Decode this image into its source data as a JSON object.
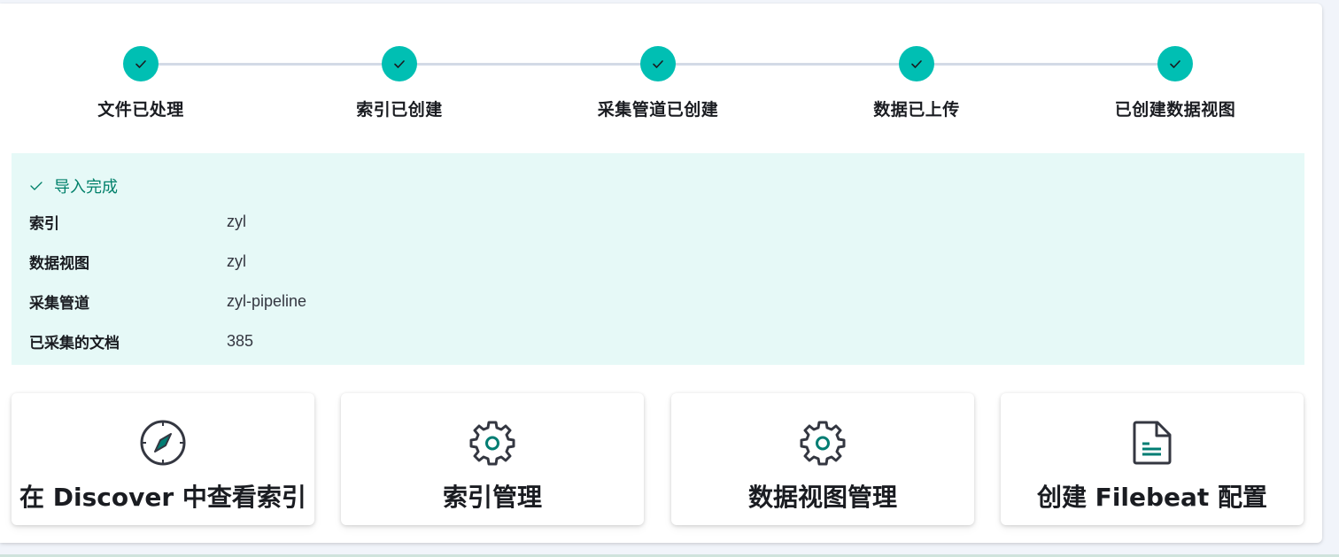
{
  "steps": [
    {
      "title": "文件已处理"
    },
    {
      "title": "索引已创建"
    },
    {
      "title": "采集管道已创建"
    },
    {
      "title": "数据已上传"
    },
    {
      "title": "已创建数据视图"
    }
  ],
  "result": {
    "title": "导入完成",
    "rows": [
      {
        "label": "索引",
        "value": "zyl"
      },
      {
        "label": "数据视图",
        "value": "zyl"
      },
      {
        "label": "采集管道",
        "value": "zyl-pipeline"
      },
      {
        "label": "已采集的文档",
        "value": "385"
      }
    ]
  },
  "cards": [
    {
      "title": "在 Discover 中查看索引",
      "icon": "compass-icon"
    },
    {
      "title": "索引管理",
      "icon": "gear-icon"
    },
    {
      "title": "数据视图管理",
      "icon": "gear-icon"
    },
    {
      "title": "创建 Filebeat 配置",
      "icon": "document-icon"
    }
  ],
  "colors": {
    "step_complete": "#00bfb3",
    "callout_background": "#e6f9f7",
    "callout_title": "#00806a"
  }
}
